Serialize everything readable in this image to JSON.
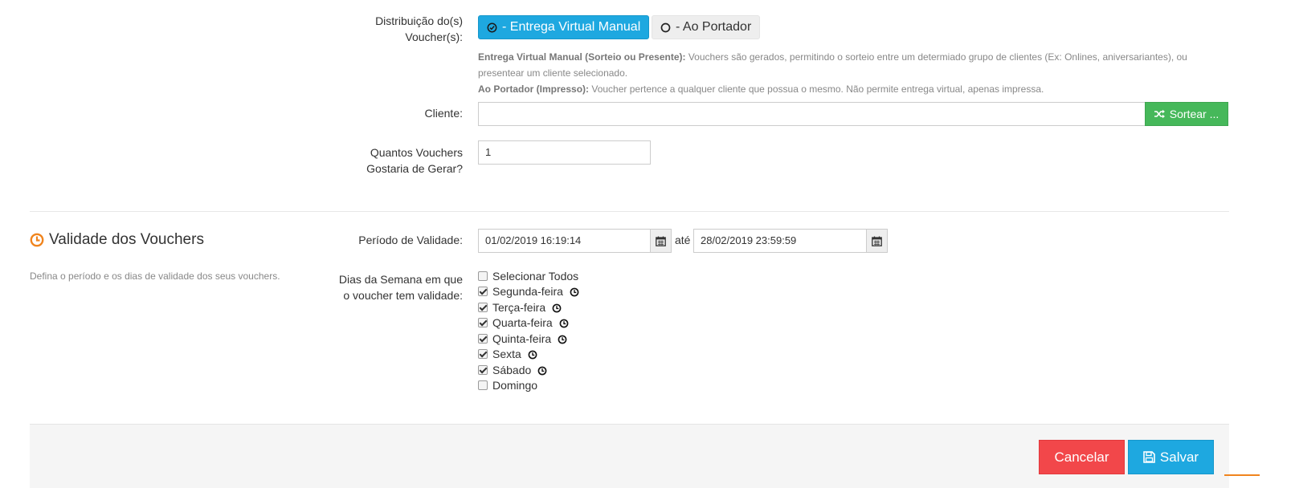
{
  "distribution": {
    "label_line1": "Distribuição do(s)",
    "label_line2": "Voucher(s):",
    "option_virtual": "- Entrega Virtual Manual",
    "option_bearer": "- Ao Portador",
    "help_virtual_title": "Entrega Virtual Manual (Sorteio ou Presente):",
    "help_virtual_text": " Vouchers são gerados, permitindo o sorteio entre um determiado grupo de clientes (Ex: Onlines, aniversariantes), ou presentear um cliente selecionado.",
    "help_bearer_title": "Ao Portador (Impresso):",
    "help_bearer_text": " Voucher pertence a qualquer cliente que possua o mesmo. Não permite entrega virtual, apenas impressa."
  },
  "client": {
    "label": "Cliente:",
    "value": "",
    "draw_button": "Sortear ..."
  },
  "quantity": {
    "label_line1": "Quantos Vouchers",
    "label_line2": "Gostaria de Gerar?",
    "value": "1"
  },
  "validity": {
    "section_title": "Validade dos Vouchers",
    "section_desc": "Defina o período e os dias de validade dos seus vouchers.",
    "period_label": "Período de Validade:",
    "start": "01/02/2019 16:19:14",
    "separator": "até",
    "end": "28/02/2019 23:59:59",
    "weekdays_label_line1": "Dias da Semana em que",
    "weekdays_label_line2": "o voucher tem validade:",
    "select_all": "Selecionar Todos",
    "days": [
      {
        "label": "Segunda-feira",
        "checked": true,
        "clock": true
      },
      {
        "label": "Terça-feira",
        "checked": true,
        "clock": true
      },
      {
        "label": "Quarta-feira",
        "checked": true,
        "clock": true
      },
      {
        "label": "Quinta-feira",
        "checked": true,
        "clock": true
      },
      {
        "label": "Sexta",
        "checked": true,
        "clock": true
      },
      {
        "label": "Sábado",
        "checked": true,
        "clock": true
      },
      {
        "label": "Domingo",
        "checked": false,
        "clock": false
      }
    ]
  },
  "footer": {
    "cancel": "Cancelar",
    "save": "Salvar"
  },
  "colors": {
    "primary": "#1ea8e0",
    "success": "#46b85a",
    "danger": "#f2474a",
    "accent_orange": "#f0841e"
  }
}
